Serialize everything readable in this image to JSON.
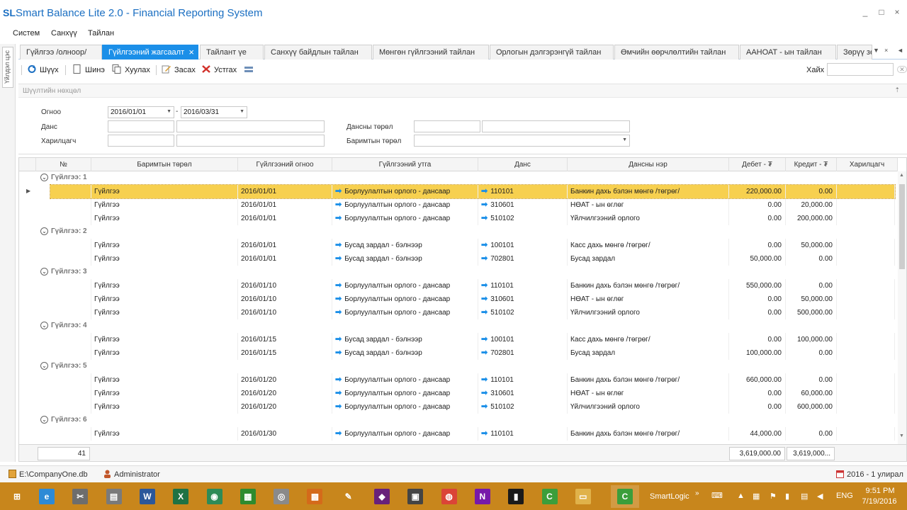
{
  "window": {
    "logo": "SL",
    "title": "Smart Balance Lite 2.0 - Financial Reporting System",
    "controls": [
      "_",
      "□",
      "×"
    ]
  },
  "menu": [
    "Систем",
    "Санхүү",
    "Тайлан"
  ],
  "left_panel": {
    "tab_label": "Үйлдэл цэс"
  },
  "tabs": [
    {
      "label": "Гүйлгээ /олноор/",
      "active": false
    },
    {
      "label": "Гүйлгээний жагсаалт",
      "active": true
    },
    {
      "label": "Тайлант үе",
      "active": false
    },
    {
      "label": "Санхүү байдлын тайлан",
      "active": false
    },
    {
      "label": "Мөнгөн гүйлгээний тайлан",
      "active": false
    },
    {
      "label": "Орлогын дэлгэрэнгүй тайлан",
      "active": false
    },
    {
      "label": "Өмчийн өөрчлөлтийн тайлан",
      "active": false
    },
    {
      "label": "ААНОАТ - ын тайлан",
      "active": false
    },
    {
      "label": "Зөрүү зө",
      "active": false
    }
  ],
  "toolbar": {
    "refresh": "Шүүх",
    "new": "Шинэ",
    "copy": "Хуулах",
    "edit": "Засах",
    "delete": "Устгах",
    "search_label": "Хайх",
    "search_value": ""
  },
  "filter": {
    "title": "Шүүлтийн нөхцөл",
    "date_label": "Огноо",
    "date_from": "2016/01/01",
    "date_sep": "-",
    "date_to": "2016/03/31",
    "account_label": "Данс",
    "account_code": "",
    "account_name": "",
    "partner_label": "Харилцагч",
    "partner_code": "",
    "partner_name": "",
    "account_type_label": "Дансны төрөл",
    "account_type_code": "",
    "account_type_name": "",
    "doc_type_label": "Баримтын төрөл",
    "doc_type_value": ""
  },
  "grid": {
    "columns": [
      "№",
      "Баримтын төрөл",
      "Гүйлгээний огноо",
      "Гүйлгээний утга",
      "Данс",
      "Дансны нэр",
      "Дебет - ₮",
      "Кредит - ₮",
      "Харилцагч"
    ],
    "groups": [
      {
        "label": "Гүйлгээ: 1",
        "rows": [
          [
            "Гүйлгээ",
            "2016/01/01",
            "Борлуулалтын орлого - дансаар",
            "110101",
            "Банкин дахь бэлэн мөнгө /төгрөг/",
            "220,000.00",
            "0.00"
          ],
          [
            "Гүйлгээ",
            "2016/01/01",
            "Борлуулалтын орлого - дансаар",
            "310601",
            "НӨАТ - ын өглөг",
            "0.00",
            "20,000.00"
          ],
          [
            "Гүйлгээ",
            "2016/01/01",
            "Борлуулалтын орлого - дансаар",
            "510102",
            "Үйлчилгээний орлого",
            "0.00",
            "200,000.00"
          ]
        ]
      },
      {
        "label": "Гүйлгээ: 2",
        "rows": [
          [
            "Гүйлгээ",
            "2016/01/01",
            "Бусад зардал - бэлнээр",
            "100101",
            "Касс дахь мөнгө /төгрөг/",
            "0.00",
            "50,000.00"
          ],
          [
            "Гүйлгээ",
            "2016/01/01",
            "Бусад зардал - бэлнээр",
            "702801",
            "Бусад зардал",
            "50,000.00",
            "0.00"
          ]
        ]
      },
      {
        "label": "Гүйлгээ: 3",
        "rows": [
          [
            "Гүйлгээ",
            "2016/01/10",
            "Борлуулалтын орлого - дансаар",
            "110101",
            "Банкин дахь бэлэн мөнгө /төгрөг/",
            "550,000.00",
            "0.00"
          ],
          [
            "Гүйлгээ",
            "2016/01/10",
            "Борлуулалтын орлого - дансаар",
            "310601",
            "НӨАТ - ын өглөг",
            "0.00",
            "50,000.00"
          ],
          [
            "Гүйлгээ",
            "2016/01/10",
            "Борлуулалтын орлого - дансаар",
            "510102",
            "Үйлчилгээний орлого",
            "0.00",
            "500,000.00"
          ]
        ]
      },
      {
        "label": "Гүйлгээ: 4",
        "rows": [
          [
            "Гүйлгээ",
            "2016/01/15",
            "Бусад зардал - бэлнээр",
            "100101",
            "Касс дахь мөнгө /төгрөг/",
            "0.00",
            "100,000.00"
          ],
          [
            "Гүйлгээ",
            "2016/01/15",
            "Бусад зардал - бэлнээр",
            "702801",
            "Бусад зардал",
            "100,000.00",
            "0.00"
          ]
        ]
      },
      {
        "label": "Гүйлгээ: 5",
        "rows": [
          [
            "Гүйлгээ",
            "2016/01/20",
            "Борлуулалтын орлого - дансаар",
            "110101",
            "Банкин дахь бэлэн мөнгө /төгрөг/",
            "660,000.00",
            "0.00"
          ],
          [
            "Гүйлгээ",
            "2016/01/20",
            "Борлуулалтын орлого - дансаар",
            "310601",
            "НӨАТ - ын өглөг",
            "0.00",
            "60,000.00"
          ],
          [
            "Гүйлгээ",
            "2016/01/20",
            "Борлуулалтын орлого - дансаар",
            "510102",
            "Үйлчилгээний орлого",
            "0.00",
            "600,000.00"
          ]
        ]
      },
      {
        "label": "Гүйлгээ: 6",
        "rows": [
          [
            "Гүйлгээ",
            "2016/01/30",
            "Борлуулалтын орлого - дансаар",
            "110101",
            "Банкин дахь бэлэн мөнгө /төгрөг/",
            "44,000.00",
            "0.00"
          ]
        ]
      }
    ],
    "footer": {
      "count": "41",
      "debit_total": "3,619,000.00",
      "credit_total": "3,619,000..."
    }
  },
  "statusbar": {
    "db": "E:\\CompanyOne.db",
    "user": "Administrator",
    "period": "2016 - 1 улирал"
  },
  "taskbar": {
    "apps": [
      {
        "name": "start-icon",
        "color": "#c8861c",
        "glyph": "⊞"
      },
      {
        "name": "ie-icon",
        "color": "#2d8ad6",
        "glyph": "e"
      },
      {
        "name": "tools-icon",
        "color": "#6d6d6d",
        "glyph": "✂"
      },
      {
        "name": "files-icon",
        "color": "#7a7a7a",
        "glyph": "▤"
      },
      {
        "name": "word-icon",
        "color": "#2b579a",
        "glyph": "W"
      },
      {
        "name": "excel-icon",
        "color": "#1f7244",
        "glyph": "X"
      },
      {
        "name": "globe-icon",
        "color": "#2e8b57",
        "glyph": "◉"
      },
      {
        "name": "project-icon",
        "color": "#2e8b2e",
        "glyph": "▦"
      },
      {
        "name": "disc-icon",
        "color": "#8a8a8a",
        "glyph": "◎"
      },
      {
        "name": "apps-icon",
        "color": "#d46a1a",
        "glyph": "▩"
      },
      {
        "name": "brush-icon",
        "color": "#c8861c",
        "glyph": "✎"
      },
      {
        "name": "visualstudio-icon",
        "color": "#68217a",
        "glyph": "◆"
      },
      {
        "name": "installer-icon",
        "color": "#444444",
        "glyph": "▣"
      },
      {
        "name": "chrome-icon",
        "color": "#db4437",
        "glyph": "◍"
      },
      {
        "name": "onenote-icon",
        "color": "#7719aa",
        "glyph": "N"
      },
      {
        "name": "chart-icon",
        "color": "#1a1a1a",
        "glyph": "▮"
      },
      {
        "name": "camtasia-icon",
        "color": "#3b9e3b",
        "glyph": "C"
      },
      {
        "name": "folder-icon",
        "color": "#e0b24a",
        "glyph": "▭"
      },
      {
        "name": "camtasia2-icon",
        "color": "#3b9e3b",
        "glyph": "C"
      }
    ],
    "active_label": "SmartLogic",
    "lang": "ENG",
    "time": "9:51 PM",
    "date": "7/19/2016"
  }
}
